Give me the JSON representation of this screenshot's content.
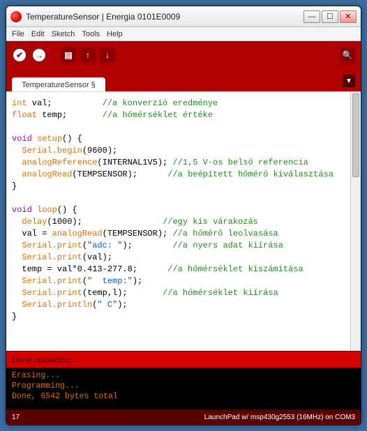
{
  "window": {
    "title": "TemperatureSensor | Energia 0101E0009"
  },
  "menu": {
    "items": [
      "File",
      "Edit",
      "Sketch",
      "Tools",
      "Help"
    ]
  },
  "toolbar": {
    "verify": "✔",
    "upload": "→",
    "new": "▤",
    "open": "↑",
    "save": "↓",
    "serial": "🔍"
  },
  "tab": {
    "label": "TemperatureSensor §"
  },
  "code": {
    "l1": {
      "a": "int",
      "b": " val;",
      "pad": "          ",
      "c": "//a konverzió eredménye"
    },
    "l2": {
      "a": "float",
      "b": " temp;",
      "pad": "       ",
      "c": "//a hőmérséklet értéke"
    },
    "l3": "",
    "l4": {
      "a": "void",
      "b": " setup",
      "c": "() {"
    },
    "l5": {
      "a": "  Serial",
      "b": ".begin",
      "c": "(9600);"
    },
    "l6": {
      "a": "  analogReference",
      "b": "(INTERNAL1V5); ",
      "c": "//1,5 V-os belső referencia"
    },
    "l7": {
      "a": "  analogRead",
      "b": "(TEMPSENSOR);",
      "pad": "      ",
      "c": "//a beépített hőmérő kiválasztása"
    },
    "l8": "}",
    "l9": "",
    "l10": {
      "a": "void",
      "b": " loop",
      "c": "() {"
    },
    "l11": {
      "a": "  delay",
      "b": "(1000);",
      "pad": "                ",
      "c": "//egy kis várakozás"
    },
    "l12": {
      "a": "  val = ",
      "b": "analogRead",
      "c": "(TEMPSENSOR); ",
      "d": "//a hőmérő leolvasása"
    },
    "l13": {
      "a": "  Serial",
      "b": ".print",
      "c": "(",
      "d": "\"adc: \"",
      "e": ");",
      "pad": "        ",
      "f": "//a nyers adat kiírása"
    },
    "l14": {
      "a": "  Serial",
      "b": ".print",
      "c": "(val);"
    },
    "l15": {
      "a": "  temp = val*0.413-277.8;",
      "pad": "      ",
      "c": "//a hőmérséklet kiszámítása"
    },
    "l16": {
      "a": "  Serial",
      "b": ".print",
      "c": "(",
      "d": "\"  temp:\"",
      "e": ");"
    },
    "l17": {
      "a": "  Serial",
      "b": ".print",
      "c": "(temp,l);",
      "pad": "       ",
      "f": "//a hőmérséklet kiírása"
    },
    "l18": {
      "a": "  Serial",
      "b": ".println",
      "c": "(",
      "d": "\" C\"",
      "e": ");"
    },
    "l19": "}"
  },
  "status": {
    "text": "Done uploading."
  },
  "console": {
    "l1": "Erasing...",
    "l2": "Programming...",
    "l3": "Done, 6542 bytes total"
  },
  "footer": {
    "line": "17",
    "board": "LaunchPad w/ msp430g2553 (16MHz) on COM3"
  }
}
